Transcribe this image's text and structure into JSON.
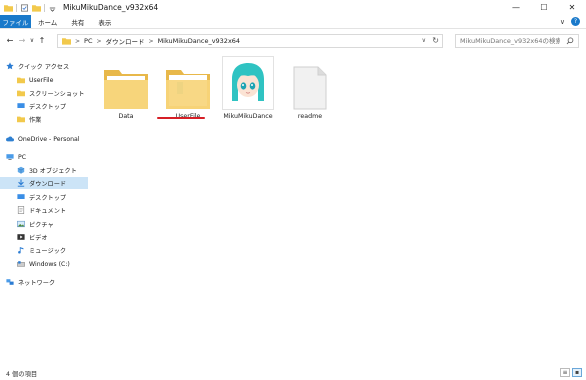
{
  "window": {
    "title": "MikuMikuDance_v932x64",
    "controls": {
      "minimize": "—",
      "maximize": "☐",
      "close": "✕"
    }
  },
  "ribbon": {
    "tabs": [
      "ファイル",
      "ホーム",
      "共有",
      "表示"
    ],
    "expand_icon": "∨",
    "help_label": "?"
  },
  "nav": {
    "back": "←",
    "forward": "→",
    "recent": "∨",
    "up": "↑"
  },
  "address": {
    "crumbs": [
      "PC",
      "ダウンロード",
      "MikuMikuDance_v932x64"
    ],
    "separator": ">",
    "dropdown": "∨",
    "refresh": "↻"
  },
  "search": {
    "placeholder": "MikuMikuDance_v932x64の検索"
  },
  "sidebar": {
    "items": [
      {
        "label": "クイック アクセス",
        "icon": "star-icon"
      },
      {
        "label": "UserFile",
        "icon": "folder-icon"
      },
      {
        "label": "スクリーンショット",
        "icon": "folder-icon"
      },
      {
        "label": "デスクトップ",
        "icon": "desktop-icon"
      },
      {
        "label": "作業",
        "icon": "folder-icon"
      },
      {
        "label": "OneDrive - Personal",
        "icon": "cloud-icon"
      },
      {
        "label": "PC",
        "icon": "pc-icon"
      },
      {
        "label": "3D オブジェクト",
        "icon": "cube-icon"
      },
      {
        "label": "ダウンロード",
        "icon": "download-icon"
      },
      {
        "label": "デスクトップ",
        "icon": "desktop-icon"
      },
      {
        "label": "ドキュメント",
        "icon": "document-icon"
      },
      {
        "label": "ピクチャ",
        "icon": "picture-icon"
      },
      {
        "label": "ビデオ",
        "icon": "video-icon"
      },
      {
        "label": "ミュージック",
        "icon": "music-icon"
      },
      {
        "label": "Windows (C:)",
        "icon": "drive-icon"
      },
      {
        "label": "ネットワーク",
        "icon": "network-icon"
      }
    ],
    "selected_index": 8
  },
  "files": [
    {
      "name": "Data",
      "icon": "folder-icon"
    },
    {
      "name": "UserFile",
      "icon": "folder-open-icon"
    },
    {
      "name": "MikuMikuDance",
      "icon": "miku-app-icon"
    },
    {
      "name": "readme",
      "icon": "text-file-icon"
    }
  ],
  "status": {
    "count": "4 個の項目"
  },
  "colors": {
    "file_tab": "#1979ca",
    "selection": "#cce4f7",
    "folder": "#f5cf6b",
    "underline": "#d61f26",
    "miku_hair": "#2fc3c2"
  }
}
